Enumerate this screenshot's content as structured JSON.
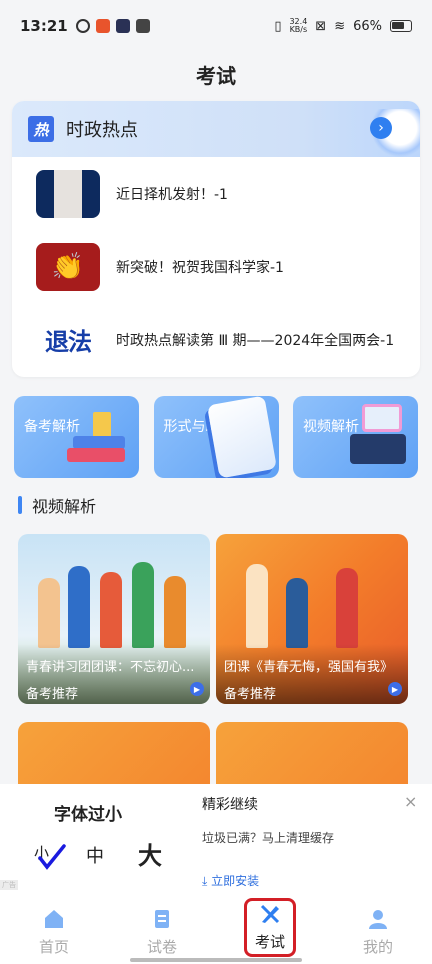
{
  "status_bar": {
    "time": "13:21",
    "net_speed_value": "32.4",
    "net_speed_unit": "KB/s",
    "battery": "66%"
  },
  "page": {
    "title": "考试"
  },
  "hot_topics": {
    "title": "时政热点",
    "logo_text": "热",
    "items": [
      {
        "title": "近日择机发射！-1"
      },
      {
        "title": "新突破！祝贺我国科学家-1"
      },
      {
        "title": "时政热点解读第 Ⅲ 期——2024年全国两会-1",
        "thumb_text": "退法"
      }
    ]
  },
  "categories": [
    {
      "label": "备考解析"
    },
    {
      "label": "形式与政策"
    },
    {
      "label": "视频解析"
    }
  ],
  "video_section": {
    "title": "视频解析",
    "videos": [
      {
        "title": "青春讲习团团课：不忘初心...",
        "subtitle": "备考推荐"
      },
      {
        "title": "团课《青春无悔，强国有我》",
        "subtitle": "备考推荐"
      }
    ]
  },
  "font_popup": {
    "title": "字体过小",
    "small": "小",
    "medium": "中",
    "large": "大"
  },
  "ad": {
    "title": "精彩继续",
    "close": "×",
    "description": "垃圾已满？马上清理缓存",
    "button": "立即安装",
    "watermark": "广告"
  },
  "nav": {
    "items": [
      {
        "label": "首页"
      },
      {
        "label": "试卷"
      },
      {
        "label": "考试"
      },
      {
        "label": "我的"
      }
    ]
  },
  "colors": {
    "accent": "#3e86f3",
    "active_highlight": "#d31f26",
    "nav_icon_inactive": "#7fb2f5"
  }
}
